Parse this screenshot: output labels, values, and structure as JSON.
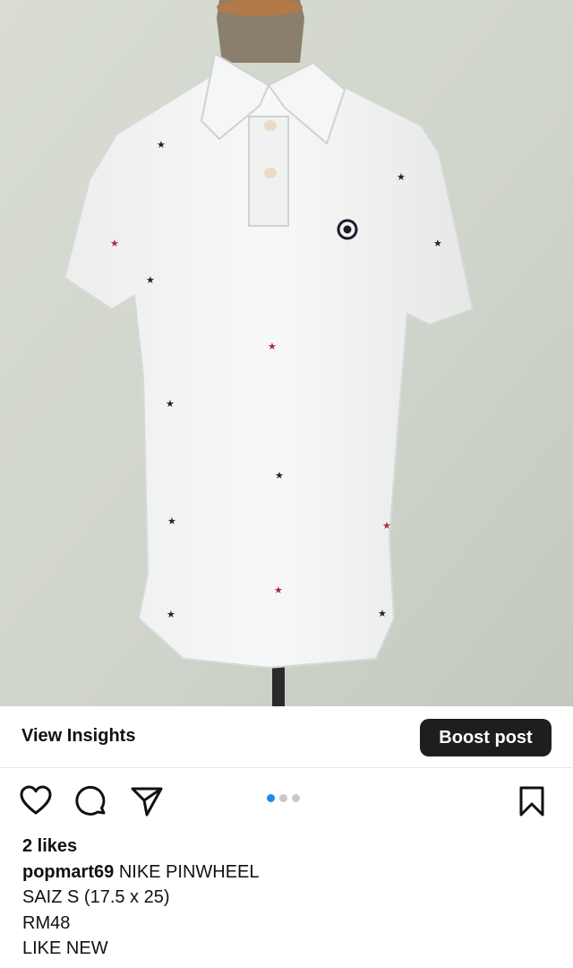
{
  "post": {
    "image_alt": "White Nike polo shirt on mannequin",
    "insights_label": "View Insights",
    "boost_label": "Boost post",
    "likes_text": "2 likes",
    "username": "popmart69",
    "caption_lines": [
      "NIKE PINWHEEL",
      "SAIZ S (17.5 x 25)",
      "RM48",
      "LIKE NEW"
    ],
    "carousel": {
      "count": 3,
      "active_index": 0
    },
    "icons": {
      "like": "heart-icon",
      "comment": "comment-icon",
      "share": "paper-plane-icon",
      "save": "bookmark-icon"
    },
    "colors": {
      "accent": "#1a8cf0",
      "button_bg": "#1e1e1e"
    }
  }
}
